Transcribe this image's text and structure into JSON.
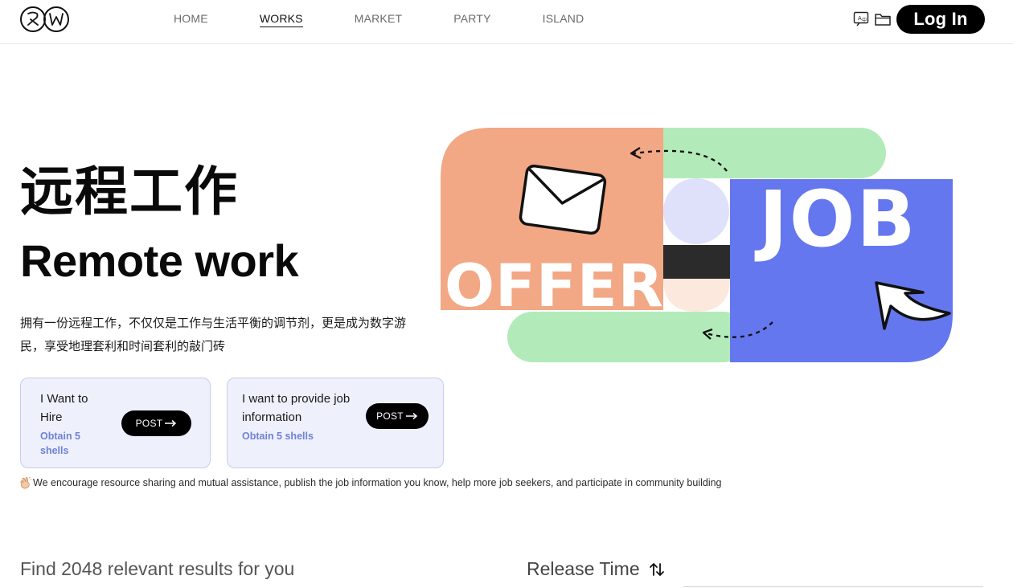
{
  "header": {
    "logo_text": "RW",
    "nav": [
      {
        "label": "HOME",
        "active": false
      },
      {
        "label": "WORKS",
        "active": true
      },
      {
        "label": "MARKET",
        "active": false
      },
      {
        "label": "PARTY",
        "active": false
      },
      {
        "label": "ISLAND",
        "active": false
      }
    ],
    "icons": [
      "translate-icon",
      "folder-icon"
    ],
    "login_label": "Log In"
  },
  "hero": {
    "title_zh": "远程工作",
    "title_en": "Remote work",
    "description": "拥有一份远程工作，不仅仅是工作与生活平衡的调节剂，更是成为数字游民，享受地理套利和时间套利的敲门砖",
    "cards": [
      {
        "title": "I Want to Hire",
        "subtitle": "Obtain 5 shells",
        "button": "POST"
      },
      {
        "title": "I want to provide job information",
        "subtitle": "Obtain 5 shells",
        "button": "POST"
      }
    ],
    "notice": "We encourage resource sharing and mutual assistance, publish the job information you know, help more job seekers, and participate in community building",
    "illustration": {
      "word_left": "OFFER",
      "word_right": "JOB",
      "colors": {
        "peach": "#f2a785",
        "green": "#b2ebb9",
        "blue": "#6577ee",
        "lavender": "#dfe1fb",
        "dark": "#2b2b2b",
        "cream": "#fde8dd"
      }
    }
  },
  "listing": {
    "results_text": "Find 2048 relevant results for you",
    "sort_label": "Release Time"
  },
  "colors": {
    "accent_blue": "#6f82d6",
    "card_bg": "#eef0fb",
    "button_bg": "#000000"
  }
}
